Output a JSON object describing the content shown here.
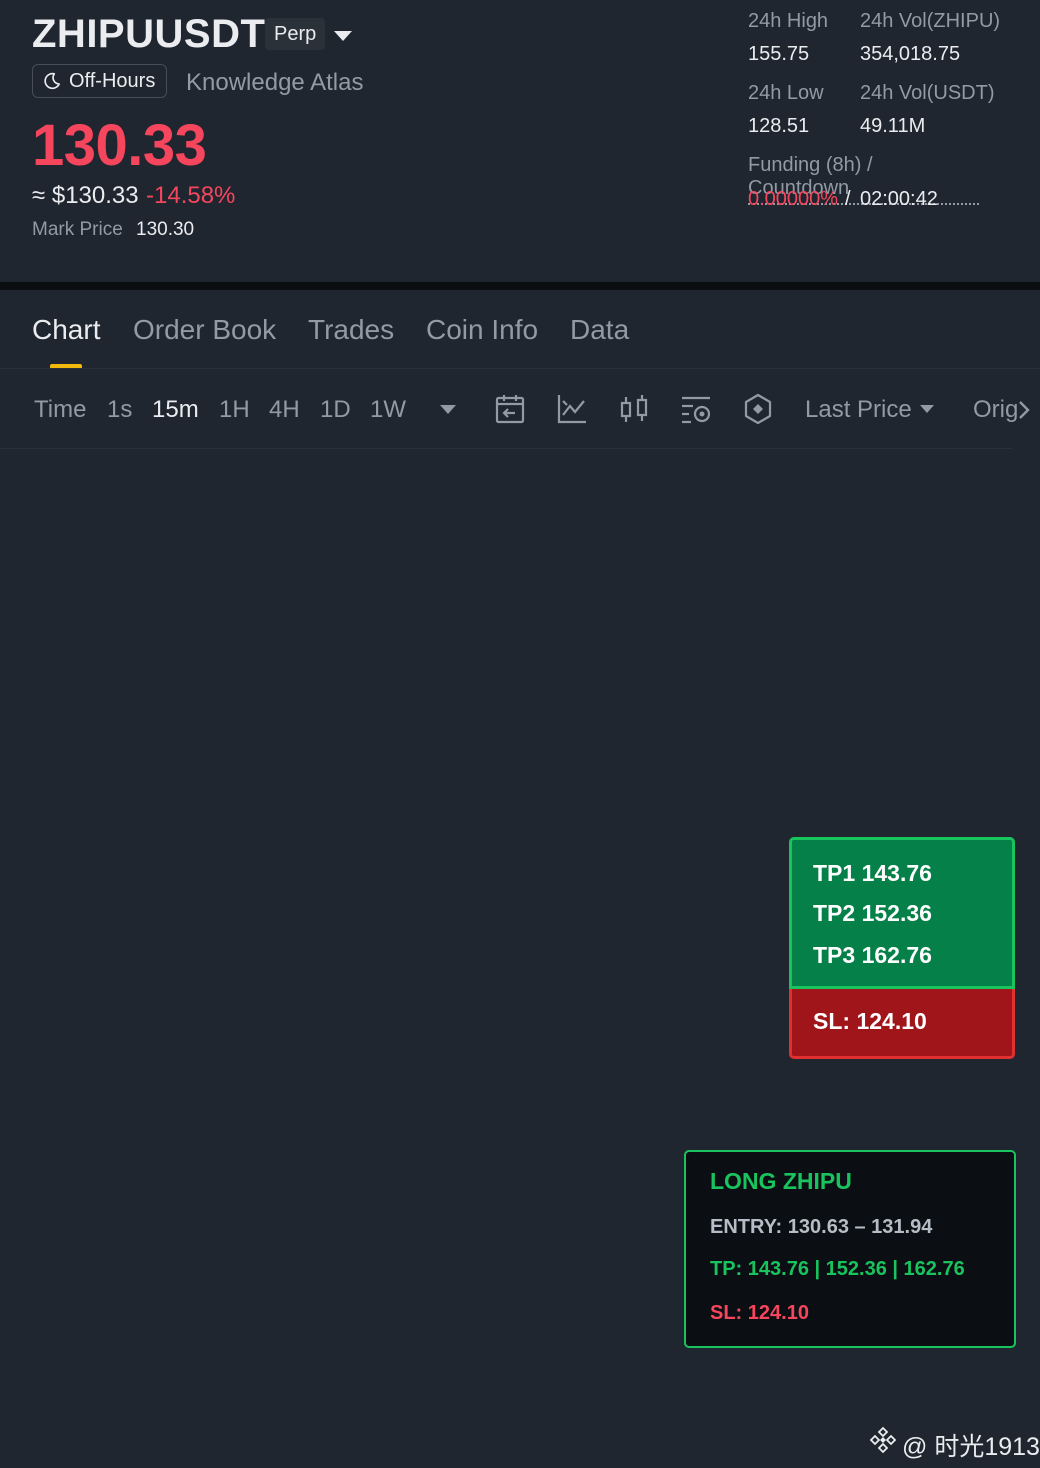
{
  "header": {
    "symbol": "ZHIPUUSDT",
    "contract_type": "Perp",
    "session_status": "Off-Hours",
    "coin_name": "Knowledge Atlas",
    "last_price": "130.33",
    "usd_approx": "≈ $130.33",
    "change_percent": "-14.58%",
    "mark_price_label": "Mark Price",
    "mark_price_value": "130.30"
  },
  "stats": {
    "high_label": "24h High",
    "high_value": "155.75",
    "vol_base_label": "24h Vol(ZHIPU)",
    "vol_base_value": "354,018.75",
    "low_label": "24h Low",
    "low_value": "128.51",
    "vol_quote_label": "24h Vol(USDT)",
    "vol_quote_value": "49.11M",
    "funding_label": "Funding (8h) / Countdown",
    "funding_rate": "0.00000%",
    "funding_separator": "/",
    "countdown": "02:00:42"
  },
  "tabs": [
    "Chart",
    "Order Book",
    "Trades",
    "Coin Info",
    "Data"
  ],
  "toolbar": {
    "intervals": [
      "Time",
      "1s",
      "15m",
      "1H",
      "4H",
      "1D",
      "1W"
    ],
    "active_interval": "15m",
    "price_type": "Last Price",
    "overflow_label": "Orig"
  },
  "tp_sl_overlay": {
    "tp1": "TP1 143.76",
    "tp2": "TP2 152.36",
    "tp3": "TP3 162.76",
    "sl": "SL: 124.10"
  },
  "signal": {
    "title": "LONG ZHIPU",
    "entry": "ENTRY: 130.63 – 131.94",
    "tp": "TP: 143.76 | 152.36 | 162.76",
    "sl": "SL: 124.10"
  },
  "watermark": {
    "text": "@ 时光1913"
  },
  "icons": [
    "moon-icon",
    "calendar-back-icon",
    "line-chart-icon",
    "candlestick-icon",
    "indicator-settings-icon",
    "hexagon-icon",
    "chevron-right-icon",
    "binance-logo-icon"
  ],
  "colors": {
    "background": "#1f2630",
    "down_red": "#f6465d",
    "up_green": "#19c45e",
    "accent_yellow": "#f0b90b",
    "muted_text": "#929aa5"
  }
}
